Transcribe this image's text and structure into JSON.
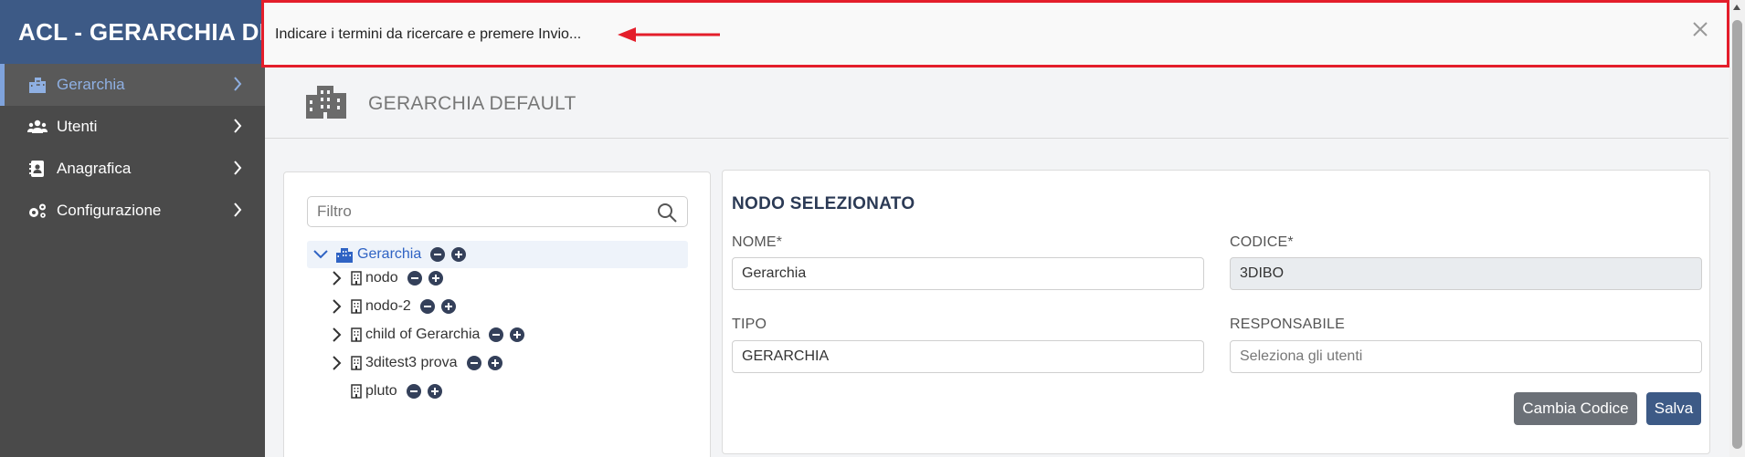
{
  "app": {
    "title": "ACL - GERARCHIA DEFAULT"
  },
  "sidebar": {
    "items": [
      {
        "label": "Gerarchia",
        "icon": "building-icon",
        "active": true
      },
      {
        "label": "Utenti",
        "icon": "users-icon",
        "active": false
      },
      {
        "label": "Anagrafica",
        "icon": "address-book-icon",
        "active": false
      },
      {
        "label": "Configurazione",
        "icon": "gears-icon",
        "active": false
      }
    ]
  },
  "header": {
    "title": "GERARCHIA DEFAULT",
    "icon": "city-icon"
  },
  "tree": {
    "filter_placeholder": "Filtro",
    "nodes": [
      {
        "label": "Gerarchia",
        "selected": true,
        "expanded": true
      },
      {
        "label": "nodo"
      },
      {
        "label": "nodo-2"
      },
      {
        "label": "child of Gerarchia"
      },
      {
        "label": "3ditest3 prova"
      },
      {
        "label": "pluto"
      }
    ]
  },
  "detail": {
    "title": "NODO SELEZIONATO",
    "nome_label": "NOME*",
    "nome_value": "Gerarchia",
    "codice_label": "CODICE*",
    "codice_value": "3DIBO",
    "tipo_label": "TIPO",
    "tipo_value": "GERARCHIA",
    "responsabile_label": "RESPONSABILE",
    "responsabile_placeholder": "Seleziona gli utenti",
    "cambia_label": "Cambia Codice",
    "salva_label": "Salva"
  },
  "notice": {
    "text": "Indicare i termini da ricercare e premere Invio..."
  },
  "colors": {
    "brand": "#3d5a86",
    "sidebar": "#4a4a4a",
    "highlight": "#e41e2b",
    "selected_text": "#2f63c4"
  }
}
